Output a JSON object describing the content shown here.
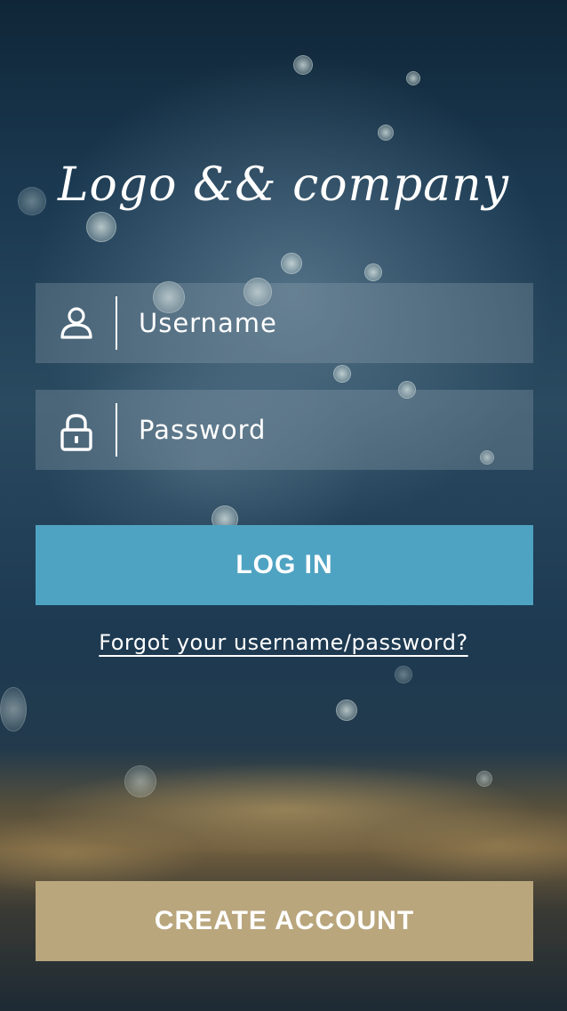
{
  "logo": {
    "text": "Logo && company"
  },
  "login_form": {
    "username": {
      "placeholder": "Username",
      "value": ""
    },
    "password": {
      "placeholder": "Password",
      "value": ""
    },
    "login_button": "LOG IN",
    "forgot_link": "Forgot your username/password?"
  },
  "create_account_button": "CREATE ACCOUNT",
  "icons": {
    "username": "user-icon",
    "password": "lock-icon"
  },
  "colors": {
    "login_button": "#4fa3c2",
    "create_account_button": "#b9a67d",
    "field_background": "rgba(160,175,185,0.28)"
  }
}
